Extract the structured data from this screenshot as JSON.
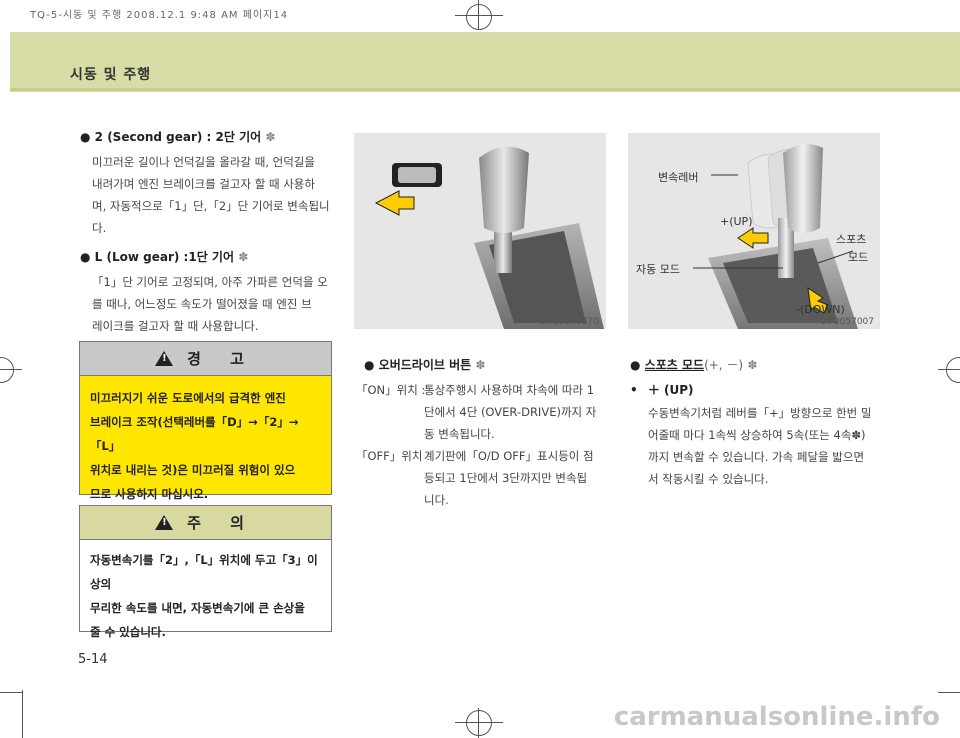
{
  "print_header": "TQ-5-시동 및 주행  2008.12.1 9:48 AM 페이지14",
  "section_title": "시동 및 주행",
  "page_number": "5-14",
  "watermark": "carmanualsonline.info",
  "left": {
    "second_gear_title": "2 (Second gear) : 2단 기어",
    "second_gear_star": "✽",
    "second_gear_text": [
      "미끄러운 길이나 언덕길을 올라갈 때, 언덕길을",
      "내려가며 엔진 브레이크를 걸고자 할 때 사용하",
      "며, 자동적으로「1」단,「2」단 기어로 변속됩니",
      "다."
    ],
    "low_gear_title": "L (Low gear) :1단 기어",
    "low_gear_star": "✽",
    "low_gear_text": [
      "「1」단 기어로 고정되며, 아주 가파른 언덕을 오",
      "를 때나, 어느정도 속도가 떨어졌을 때 엔진 브",
      "레이크를 걸고자 할 때 사용합니다."
    ]
  },
  "warning": {
    "title": "경 고",
    "lines": [
      "미끄러지기 쉬운 도로에서의 급격한 엔진",
      "브레이크 조작(선택레버를「D」→「2」→「L」",
      "위치로 내리는 것)은 미끄러질 위험이 있으",
      "므로 사용하지 마십시오."
    ]
  },
  "caution": {
    "title": "주 의",
    "lines": [
      "자동변속기를「2」,「L」위치에 두고「3」이상의",
      "무리한 속도를 내면, 자동변속기에 큰 손상을",
      "줄 수 있습니다."
    ]
  },
  "middle": {
    "image_code": "OTQ057007G",
    "overdrive_title": "오버드라이브 버튼",
    "overdrive_star": "✽",
    "on_label": "「ON」위치 :",
    "on_text": [
      "통상주행시 사용하며 차속에 따라 1",
      "단에서 4단 (OVER-DRIVE)까지 자",
      "동 변속됩니다."
    ],
    "off_label": "「OFF」위치 :",
    "off_text": [
      "계기판에「O/D OFF」표시등이 점",
      "등되고 1단에서 3단까지만 변속됩",
      "니다."
    ]
  },
  "right": {
    "image_code": "OTQ057007",
    "label_lever": "변속레버",
    "label_up": "+(UP)",
    "label_auto": "자동 모드",
    "label_sport_1": "스포츠",
    "label_sport_2": "모드",
    "label_down": "-(DOWN)",
    "sport_title": "스포츠 모드",
    "sport_title_suffix": "(+, －)",
    "sport_star": "✽",
    "up_bullet": "•",
    "up_title": "＋ (UP)",
    "up_text": [
      "수동변속기처럼 레버를「+」방향으로 한번 밀",
      "어줄때 마다 1속씩 상승하여 5속(또는 4속✽)",
      "까지 변속할 수 있습니다.  가속 페달을 밟으면",
      "서 작동시킬 수 있습니다."
    ]
  }
}
